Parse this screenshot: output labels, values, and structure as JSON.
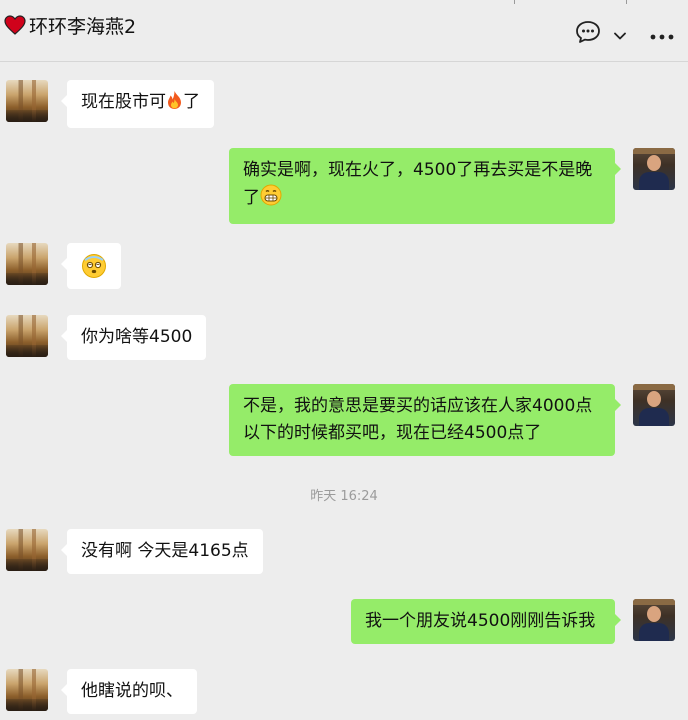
{
  "header": {
    "title": "环环李海燕2",
    "icons": [
      "heart-icon",
      "chat-bubble-icon",
      "chevron-down-icon",
      "more-icon"
    ],
    "accent_color": "#d0021b"
  },
  "messages": [
    {
      "side": "left",
      "text": "现在股市可",
      "trailing_emoji": "fire"
    },
    {
      "side": "right",
      "text": "确实是啊，现在火了，4500了再去买是不是晚了",
      "trailing_emoji": "grin"
    },
    {
      "side": "left",
      "text": "",
      "trailing_emoji": "dizzy-face"
    },
    {
      "side": "left",
      "text": "你为啥等4500"
    },
    {
      "side": "right",
      "text": "不是，我的意思是要买的话应该在人家4000点以下的时候都买吧，现在已经4500点了"
    },
    {
      "side": "left",
      "text": "没有啊 今天是4165点"
    },
    {
      "side": "right",
      "text": "我一个朋友说4500刚刚告诉我"
    },
    {
      "side": "left",
      "text": "他瞎说的呗、"
    }
  ],
  "msg": {
    "m1_text": "现在股市可",
    "m1_suffix": "了",
    "m2_line1": "确实是啊，现在火了，4500了再去买是不是晚",
    "m2_line2": "了",
    "m4_text": "你为啥等4500",
    "m5_line1": "不是，我的意思是要买的话应该在人家4000点",
    "m5_line2": "以下的时候都买吧，现在已经4500点了",
    "m6_text": "没有啊 今天是4165点",
    "m7_text": "我一个朋友说4500刚刚告诉我",
    "m8_text": "他瞎说的呗、"
  },
  "timestamp": "昨天 16:24",
  "colors": {
    "background": "#ededed",
    "bubble_self": "#95ec69",
    "bubble_other": "#ffffff",
    "timestamp_text": "#9b9b9b"
  }
}
